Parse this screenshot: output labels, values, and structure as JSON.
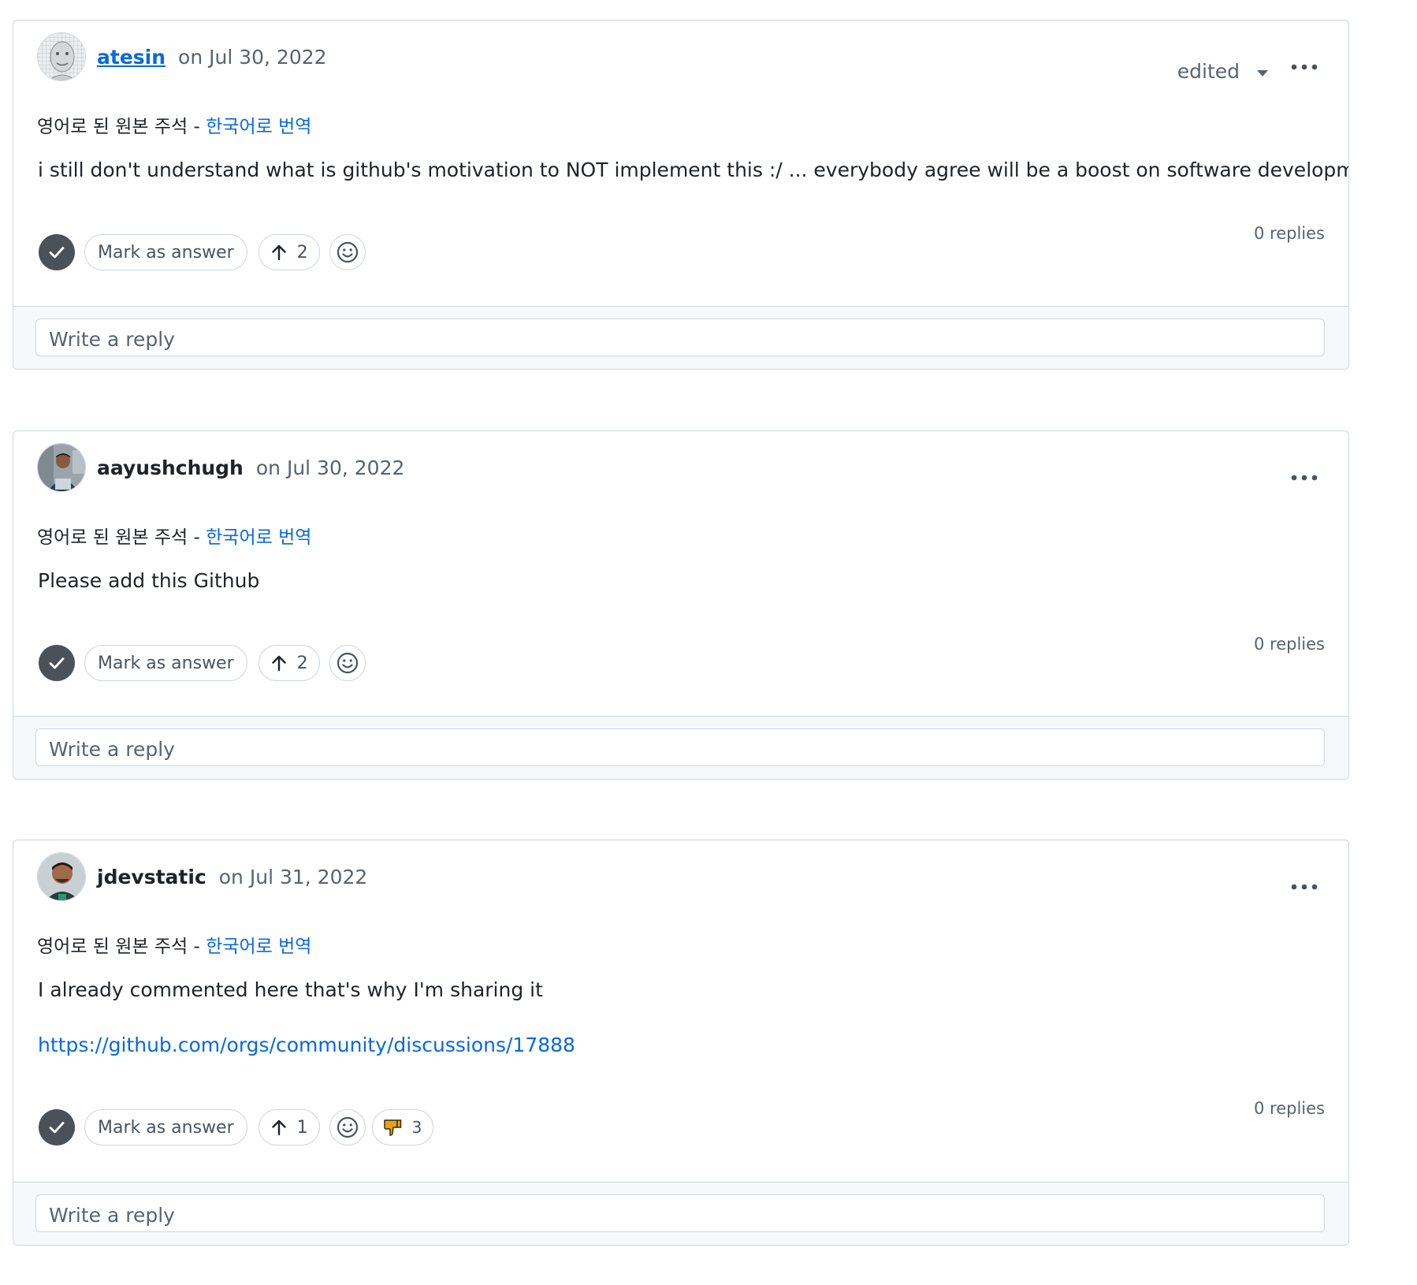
{
  "common": {
    "translate_prefix": "영어로 된 원본 주석 - ",
    "translate_link": "한국어로 번역",
    "mark_as_answer": "Mark as answer",
    "reply_placeholder": "Write a reply"
  },
  "comments": [
    {
      "author": "atesin",
      "date": "on Jul 30, 2022",
      "edited": "edited",
      "body": "i still don't understand what is github's motivation to NOT implement this :/ ... everybody agree will be a boost on software development!",
      "upvotes": "2",
      "replies": "0 replies"
    },
    {
      "author": "aayushchugh",
      "date": "on Jul 30, 2022",
      "body": "Please add this Github",
      "upvotes": "2",
      "replies": "0 replies"
    },
    {
      "author": "jdevstatic",
      "date": "on Jul 31, 2022",
      "body": "I already commented here that's why I'm sharing it",
      "link": "https://github.com/orgs/community/discussions/17888",
      "upvotes": "1",
      "reaction_count": "3",
      "replies": "0 replies"
    }
  ],
  "icons": {
    "check": "check-icon",
    "upvote": "arrow-up-icon",
    "emoji": "smiley-icon",
    "reaction": "thumbs-down-icon",
    "more": "kebab-horizontal-icon",
    "caret": "triangle-down-icon"
  },
  "colors": {
    "link": "#0969da",
    "border": "#d0d7de",
    "muted": "#59636e",
    "check_bg": "#4a5159",
    "footer_bg": "#f6f8fa",
    "reaction": "#e3a21a"
  }
}
